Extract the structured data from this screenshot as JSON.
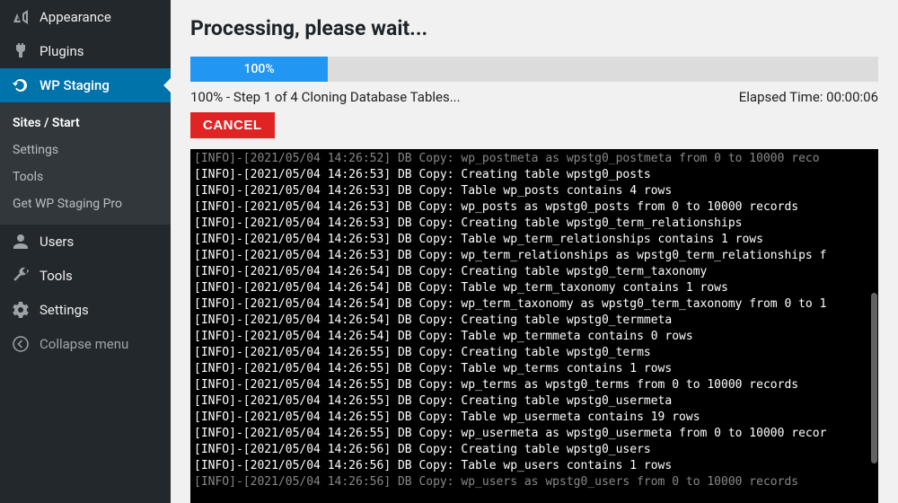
{
  "sidebar": {
    "items": [
      {
        "label": "Appearance",
        "icon": "appearance-icon"
      },
      {
        "label": "Plugins",
        "icon": "plugin-icon"
      },
      {
        "label": "WP Staging",
        "icon": "refresh-icon",
        "current": true
      },
      {
        "label": "Users",
        "icon": "user-icon"
      },
      {
        "label": "Tools",
        "icon": "wrench-icon"
      },
      {
        "label": "Settings",
        "icon": "gear-icon"
      },
      {
        "label": "Collapse menu",
        "icon": "collapse-icon"
      }
    ],
    "submenu": [
      {
        "label": "Sites / Start",
        "current": true
      },
      {
        "label": "Settings"
      },
      {
        "label": "Tools"
      },
      {
        "label": "Get WP Staging Pro"
      }
    ]
  },
  "main": {
    "title": "Processing, please wait...",
    "progress_percent_label": "100%",
    "progress_fill_pct": 20,
    "status_text": "100% - Step 1 of 4 Cloning Database Tables...",
    "elapsed_label": "Elapsed Time: 00:00:06",
    "cancel_label": "CANCEL"
  },
  "log_lines": [
    {
      "t": "[INFO]-[2021/05/04 14:26:52] DB Copy: wp_postmeta as wpstg0_postmeta from 0 to 10000 reco",
      "faded": true
    },
    {
      "t": "[INFO]-[2021/05/04 14:26:53] DB Copy: Creating table wpstg0_posts"
    },
    {
      "t": "[INFO]-[2021/05/04 14:26:53] DB Copy: Table wp_posts contains 4 rows"
    },
    {
      "t": "[INFO]-[2021/05/04 14:26:53] DB Copy: wp_posts as wpstg0_posts from 0 to 10000 records"
    },
    {
      "t": "[INFO]-[2021/05/04 14:26:53] DB Copy: Creating table wpstg0_term_relationships"
    },
    {
      "t": "[INFO]-[2021/05/04 14:26:53] DB Copy: Table wp_term_relationships contains 1 rows"
    },
    {
      "t": "[INFO]-[2021/05/04 14:26:53] DB Copy: wp_term_relationships as wpstg0_term_relationships f"
    },
    {
      "t": "[INFO]-[2021/05/04 14:26:54] DB Copy: Creating table wpstg0_term_taxonomy"
    },
    {
      "t": "[INFO]-[2021/05/04 14:26:54] DB Copy: Table wp_term_taxonomy contains 1 rows"
    },
    {
      "t": "[INFO]-[2021/05/04 14:26:54] DB Copy: wp_term_taxonomy as wpstg0_term_taxonomy from 0 to 1"
    },
    {
      "t": "[INFO]-[2021/05/04 14:26:54] DB Copy: Creating table wpstg0_termmeta"
    },
    {
      "t": "[INFO]-[2021/05/04 14:26:54] DB Copy: Table wp_termmeta contains 0 rows"
    },
    {
      "t": "[INFO]-[2021/05/04 14:26:55] DB Copy: Creating table wpstg0_terms"
    },
    {
      "t": "[INFO]-[2021/05/04 14:26:55] DB Copy: Table wp_terms contains 1 rows"
    },
    {
      "t": "[INFO]-[2021/05/04 14:26:55] DB Copy: wp_terms as wpstg0_terms from 0 to 10000 records"
    },
    {
      "t": "[INFO]-[2021/05/04 14:26:55] DB Copy: Creating table wpstg0_usermeta"
    },
    {
      "t": "[INFO]-[2021/05/04 14:26:55] DB Copy: Table wp_usermeta contains 19 rows"
    },
    {
      "t": "[INFO]-[2021/05/04 14:26:55] DB Copy: wp_usermeta as wpstg0_usermeta from 0 to 10000 recor"
    },
    {
      "t": "[INFO]-[2021/05/04 14:26:56] DB Copy: Creating table wpstg0_users"
    },
    {
      "t": "[INFO]-[2021/05/04 14:26:56] DB Copy: Table wp_users contains 1 rows"
    },
    {
      "t": "[INFO]-[2021/05/04 14:26:56] DB Copy: wp_users as wpstg0_users from 0 to 10000 records",
      "faded": true
    }
  ]
}
